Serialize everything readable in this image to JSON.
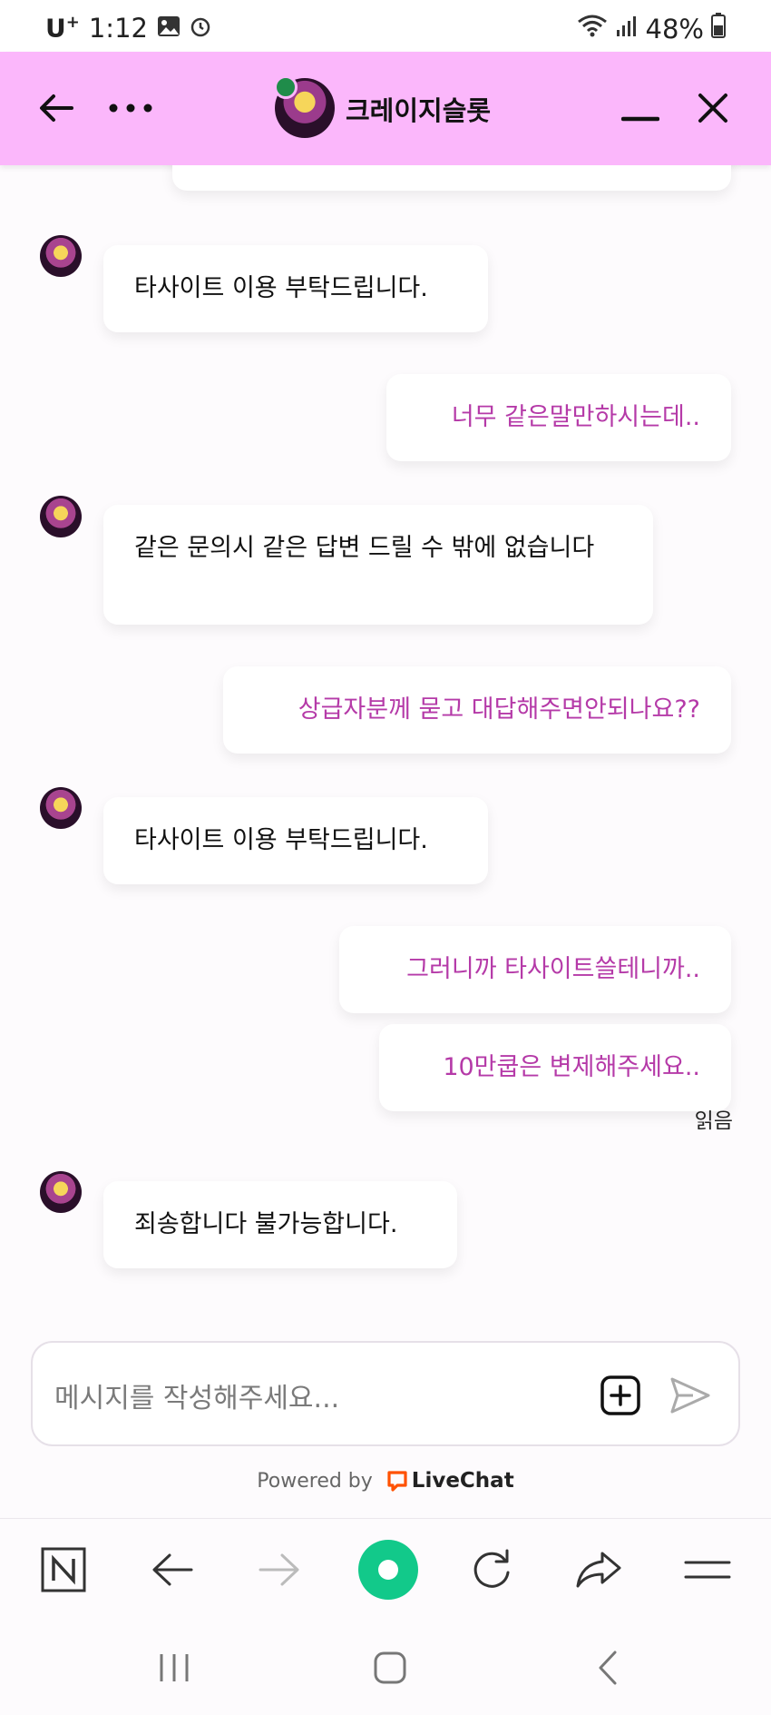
{
  "status_bar": {
    "carrier": "U",
    "carrier_sup": "+",
    "time": "1:12",
    "battery": "48%"
  },
  "header": {
    "title": "크레이지슬롯"
  },
  "messages": [
    {
      "from": "agent",
      "text": "타사이트 이용 부탁드립니다."
    },
    {
      "from": "visitor",
      "text": "너무 같은말만하시는데.."
    },
    {
      "from": "agent",
      "text": "같은 문의시 같은 답변 드릴 수 밖에 없습니다"
    },
    {
      "from": "visitor",
      "text": "상급자분께 묻고 대답해주면안되나요??"
    },
    {
      "from": "agent",
      "text": "타사이트 이용 부탁드립니다."
    },
    {
      "from": "visitor",
      "text": "그러니까 타사이트쓸테니까.."
    },
    {
      "from": "visitor",
      "text": "10만쿱은 변제해주세요.."
    },
    {
      "from": "agent",
      "text": "죄송합니다 불가능합니다."
    }
  ],
  "read_receipt": "읽음",
  "composer": {
    "placeholder": "메시지를 작성해주세요..."
  },
  "powered_by": {
    "prefix": "Powered by",
    "brand": "LiveChat"
  },
  "colors": {
    "header_bg": "#fbb7fb",
    "visitor_text": "#b53aa8",
    "online": "#1f8c4a",
    "browser_green": "#12c98a",
    "livechat_orange": "#ff5100"
  }
}
